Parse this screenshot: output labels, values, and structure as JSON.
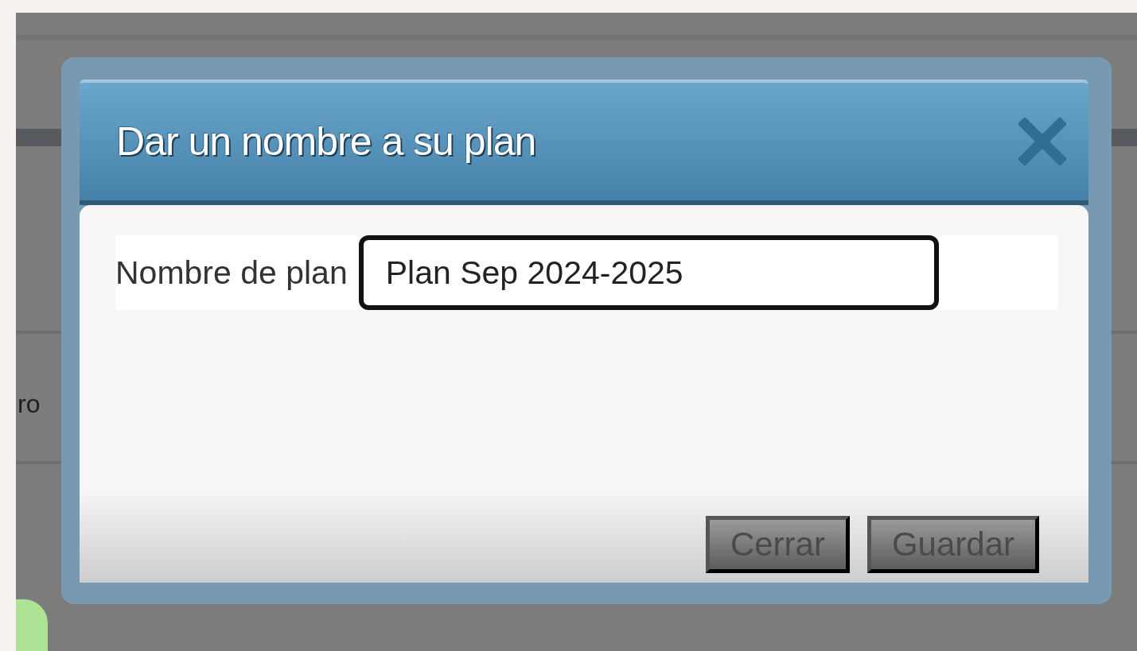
{
  "background": {
    "text": "ro"
  },
  "dialog": {
    "title": "Dar un nombre a su plan",
    "field": {
      "label": "Nombre de plan",
      "value": "Plan Sep 2024-2025"
    },
    "buttons": [
      {
        "label": "Cerrar"
      },
      {
        "label": "Guardar"
      }
    ]
  }
}
